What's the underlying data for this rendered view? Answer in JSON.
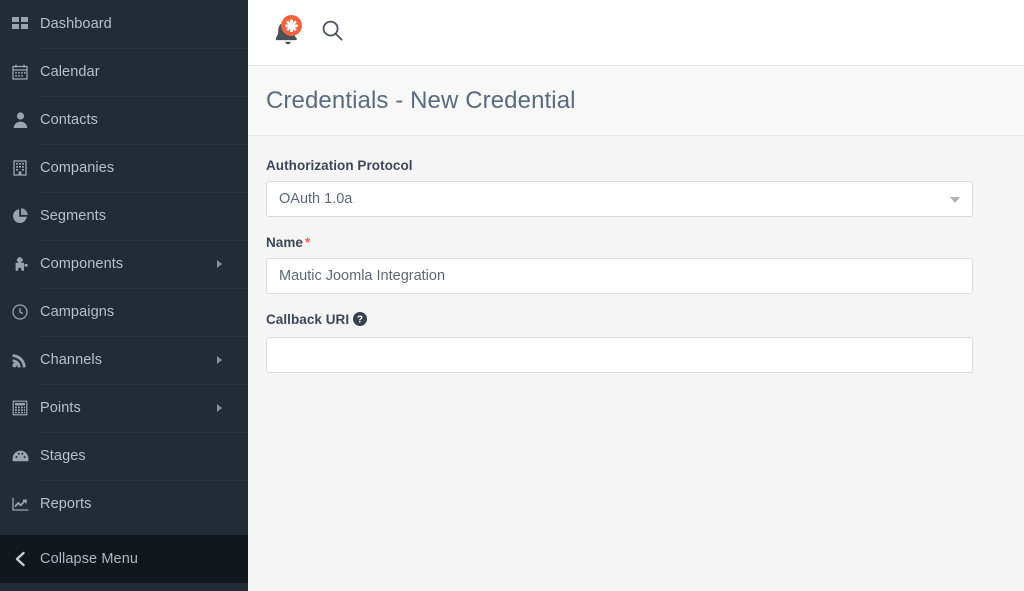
{
  "sidebar": {
    "items": [
      {
        "label": "Dashboard",
        "icon": "grid-icon",
        "has_submenu": false
      },
      {
        "label": "Calendar",
        "icon": "calendar-icon",
        "has_submenu": false
      },
      {
        "label": "Contacts",
        "icon": "user-icon",
        "has_submenu": false
      },
      {
        "label": "Companies",
        "icon": "building-icon",
        "has_submenu": false
      },
      {
        "label": "Segments",
        "icon": "pie-chart-icon",
        "has_submenu": false
      },
      {
        "label": "Components",
        "icon": "puzzle-icon",
        "has_submenu": true
      },
      {
        "label": "Campaigns",
        "icon": "clock-icon",
        "has_submenu": false
      },
      {
        "label": "Channels",
        "icon": "rss-icon",
        "has_submenu": true
      },
      {
        "label": "Points",
        "icon": "calculator-icon",
        "has_submenu": true
      },
      {
        "label": "Stages",
        "icon": "gauge-icon",
        "has_submenu": false
      },
      {
        "label": "Reports",
        "icon": "line-chart-icon",
        "has_submenu": false
      }
    ],
    "collapse": {
      "label": "Collapse Menu",
      "icon": "chevron-left-icon"
    },
    "background_color": "#222b36",
    "collapse_background_color": "#12171e"
  },
  "topbar": {
    "notifications": {
      "icon": "bell-icon",
      "badge_icon": "asterisk-icon",
      "badge_color": "#f4613f"
    },
    "search": {
      "icon": "search-icon"
    }
  },
  "header": {
    "title": "Credentials - New Credential"
  },
  "form": {
    "fields": [
      {
        "name": "authorization-protocol",
        "label": "Authorization Protocol",
        "type": "select",
        "value": "OAuth 1.0a",
        "required": false,
        "has_help": false
      },
      {
        "name": "credential-name",
        "label": "Name",
        "type": "text",
        "value": "Mautic Joomla Integration",
        "placeholder": "",
        "required": true,
        "required_marker": "*",
        "has_help": false
      },
      {
        "name": "callback-uri",
        "label": "Callback URI",
        "type": "text",
        "value": "",
        "placeholder": "",
        "required": false,
        "has_help": true,
        "help_icon": "question-circle-icon"
      }
    ]
  },
  "colors": {
    "accent": "#f4613f",
    "title": "#5b6b7f",
    "page_background": "#f5f5f5"
  }
}
